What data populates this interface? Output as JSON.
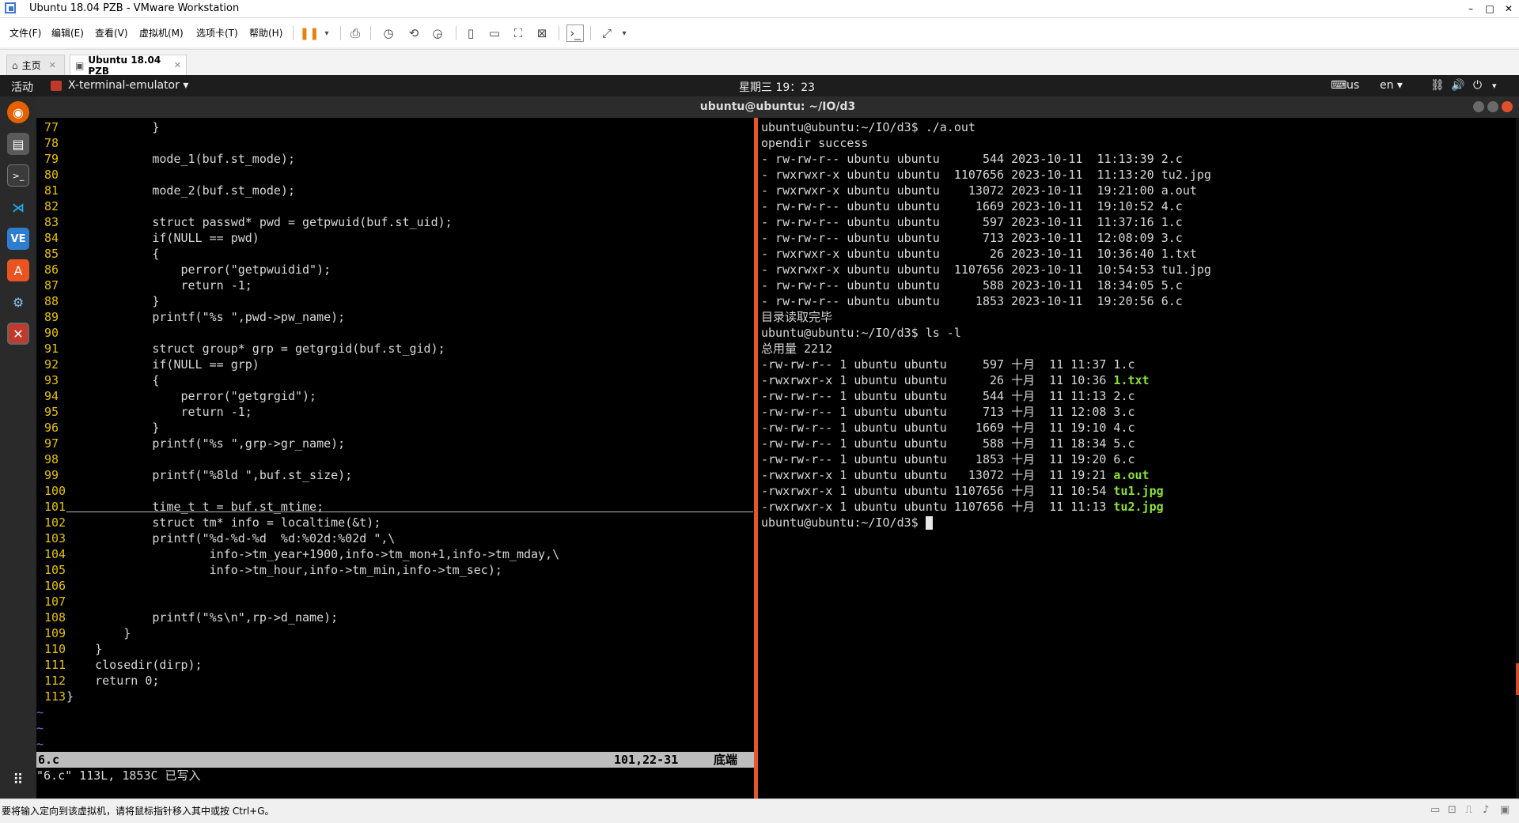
{
  "window": {
    "title": "Ubuntu 18.04 PZB - VMware Workstation",
    "controls": [
      "–",
      "□",
      "✕"
    ]
  },
  "menu": [
    "文件(F)",
    "编辑(E)",
    "查看(V)",
    "虚拟机(M)",
    "选项卡(T)",
    "帮助(H)"
  ],
  "tabs": [
    {
      "label": "主页",
      "icon": "home-icon"
    },
    {
      "label": "Ubuntu 18.04 PZB",
      "icon": "vm-icon"
    }
  ],
  "ubuntu_bar": {
    "activities": "活动",
    "app_menu": "X-terminal-emulator ▾",
    "clock": "星期三 19：23",
    "keyboard": "us",
    "lang": "en ▾"
  },
  "terminal": {
    "title": "ubuntu@ubuntu: ~/IO/d3"
  },
  "vim": {
    "lines": [
      {
        "n": "77",
        "t": "            }"
      },
      {
        "n": "78",
        "t": ""
      },
      {
        "n": "79",
        "t": "            mode_1(buf.st_mode);"
      },
      {
        "n": "80",
        "t": ""
      },
      {
        "n": "81",
        "t": "            mode_2(buf.st_mode);"
      },
      {
        "n": "82",
        "t": ""
      },
      {
        "n": "83",
        "t": "            struct passwd* pwd = getpwuid(buf.st_uid);"
      },
      {
        "n": "84",
        "t": "            if(NULL == pwd)"
      },
      {
        "n": "85",
        "t": "            {"
      },
      {
        "n": "86",
        "t": "                perror(\"getpwuidid\");"
      },
      {
        "n": "87",
        "t": "                return -1;"
      },
      {
        "n": "88",
        "t": "            }"
      },
      {
        "n": "89",
        "t": "            printf(\"%s \",pwd->pw_name);"
      },
      {
        "n": "90",
        "t": ""
      },
      {
        "n": "91",
        "t": "            struct group* grp = getgrgid(buf.st_gid);"
      },
      {
        "n": "92",
        "t": "            if(NULL == grp)"
      },
      {
        "n": "93",
        "t": "            {"
      },
      {
        "n": "94",
        "t": "                perror(\"getgrgid\");"
      },
      {
        "n": "95",
        "t": "                return -1;"
      },
      {
        "n": "96",
        "t": "            }"
      },
      {
        "n": "97",
        "t": "            printf(\"%s \",grp->gr_name);"
      },
      {
        "n": "98",
        "t": ""
      },
      {
        "n": "99",
        "t": "            printf(\"%8ld \",buf.st_size);"
      },
      {
        "n": "100",
        "t": ""
      },
      {
        "n": "101",
        "t": "            time_t t = buf.st_mtime;"
      },
      {
        "n": "102",
        "t": "            struct tm* info = localtime(&t);"
      },
      {
        "n": "103",
        "t": "            printf(\"%d-%d-%d  %d:%02d:%02d \",\\"
      },
      {
        "n": "104",
        "t": "                    info->tm_year+1900,info->tm_mon+1,info->tm_mday,\\"
      },
      {
        "n": "105",
        "t": "                    info->tm_hour,info->tm_min,info->tm_sec);"
      },
      {
        "n": "106",
        "t": ""
      },
      {
        "n": "107",
        "t": ""
      },
      {
        "n": "108",
        "t": "            printf(\"%s\\n\",rp->d_name);"
      },
      {
        "n": "109",
        "t": "        }"
      },
      {
        "n": "110",
        "t": "    }"
      },
      {
        "n": "111",
        "t": "    closedir(dirp);"
      },
      {
        "n": "112",
        "t": "    return 0;"
      },
      {
        "n": "113",
        "t": "}"
      }
    ],
    "tildes": [
      "~",
      "~",
      "~"
    ],
    "status": {
      "file": "6.c",
      "pos": "101,22-31",
      "where": "底端"
    },
    "cmdline": "\"6.c\" 113L, 1853C 已写入"
  },
  "shell": {
    "lines": [
      {
        "t": "ubuntu@ubuntu:~/IO/d3$ ./a.out"
      },
      {
        "t": "opendir success"
      },
      {
        "t": "- rw-rw-r-- ubuntu ubuntu      544 2023-10-11  11:13:39 2.c"
      },
      {
        "t": "- rwxrwxr-x ubuntu ubuntu  1107656 2023-10-11  11:13:20 tu2.jpg"
      },
      {
        "t": "- rwxrwxr-x ubuntu ubuntu    13072 2023-10-11  19:21:00 a.out"
      },
      {
        "t": "- rw-rw-r-- ubuntu ubuntu     1669 2023-10-11  19:10:52 4.c"
      },
      {
        "t": "- rw-rw-r-- ubuntu ubuntu      597 2023-10-11  11:37:16 1.c"
      },
      {
        "t": "- rw-rw-r-- ubuntu ubuntu      713 2023-10-11  12:08:09 3.c"
      },
      {
        "t": "- rwxrwxr-x ubuntu ubuntu       26 2023-10-11  10:36:40 1.txt"
      },
      {
        "t": "- rwxrwxr-x ubuntu ubuntu  1107656 2023-10-11  10:54:53 tu1.jpg"
      },
      {
        "t": "- rw-rw-r-- ubuntu ubuntu      588 2023-10-11  18:34:05 5.c"
      },
      {
        "t": "- rw-rw-r-- ubuntu ubuntu     1853 2023-10-11  19:20:56 6.c"
      },
      {
        "t": "目录读取完毕"
      },
      {
        "t": "ubuntu@ubuntu:~/IO/d3$ ls -l"
      },
      {
        "t": "总用量 2212"
      },
      {
        "t": "-rw-rw-r-- 1 ubuntu ubuntu     597 十月  11 11:37 ",
        "f": "1.c",
        "exe": false
      },
      {
        "t": "-rwxrwxr-x 1 ubuntu ubuntu      26 十月  11 10:36 ",
        "f": "1.txt",
        "exe": true
      },
      {
        "t": "-rw-rw-r-- 1 ubuntu ubuntu     544 十月  11 11:13 ",
        "f": "2.c",
        "exe": false
      },
      {
        "t": "-rw-rw-r-- 1 ubuntu ubuntu     713 十月  11 12:08 ",
        "f": "3.c",
        "exe": false
      },
      {
        "t": "-rw-rw-r-- 1 ubuntu ubuntu    1669 十月  11 19:10 ",
        "f": "4.c",
        "exe": false
      },
      {
        "t": "-rw-rw-r-- 1 ubuntu ubuntu     588 十月  11 18:34 ",
        "f": "5.c",
        "exe": false
      },
      {
        "t": "-rw-rw-r-- 1 ubuntu ubuntu    1853 十月  11 19:20 ",
        "f": "6.c",
        "exe": false
      },
      {
        "t": "-rwxrwxr-x 1 ubuntu ubuntu   13072 十月  11 19:21 ",
        "f": "a.out",
        "exe": true
      },
      {
        "t": "-rwxrwxr-x 1 ubuntu ubuntu 1107656 十月  11 10:54 ",
        "f": "tu1.jpg",
        "exe": true
      },
      {
        "t": "-rwxrwxr-x 1 ubuntu ubuntu 1107656 十月  11 11:13 ",
        "f": "tu2.jpg",
        "exe": true
      }
    ],
    "prompt": "ubuntu@ubuntu:~/IO/d3$ "
  },
  "hostbar": {
    "message": "要将输入定向到该虚拟机，请将鼠标指针移入其中或按 Ctrl+G。"
  },
  "colors": {
    "line_number": "#e6c200",
    "exe_file": "#8ae234",
    "pane_separator": "#e4572e"
  }
}
